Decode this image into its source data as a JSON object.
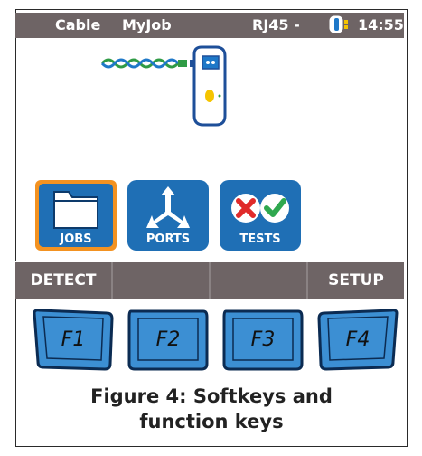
{
  "statusbar": {
    "menu_cable": "Cable",
    "job_name": "MyJob",
    "connector": "RJ45 -",
    "time": "14:55",
    "battery_icon": "battery-icon"
  },
  "apps": [
    {
      "label": "JOBS",
      "icon": "folder-icon",
      "selected": true
    },
    {
      "label": "PORTS",
      "icon": "ports-icon",
      "selected": false
    },
    {
      "label": "TESTS",
      "icon": "tests-icon",
      "selected": false
    }
  ],
  "softkeys": [
    "DETECT",
    "",
    "",
    "SETUP"
  ],
  "function_keys": [
    "F1",
    "F2",
    "F3",
    "F4"
  ],
  "caption_line1": "Figure 4: Softkeys and",
  "caption_line2": "function keys",
  "colors": {
    "bar": "#6e6465",
    "icon_blue": "#1f6fb5",
    "fkey_blue": "#3c8fd3",
    "selected_border": "#f39221"
  }
}
